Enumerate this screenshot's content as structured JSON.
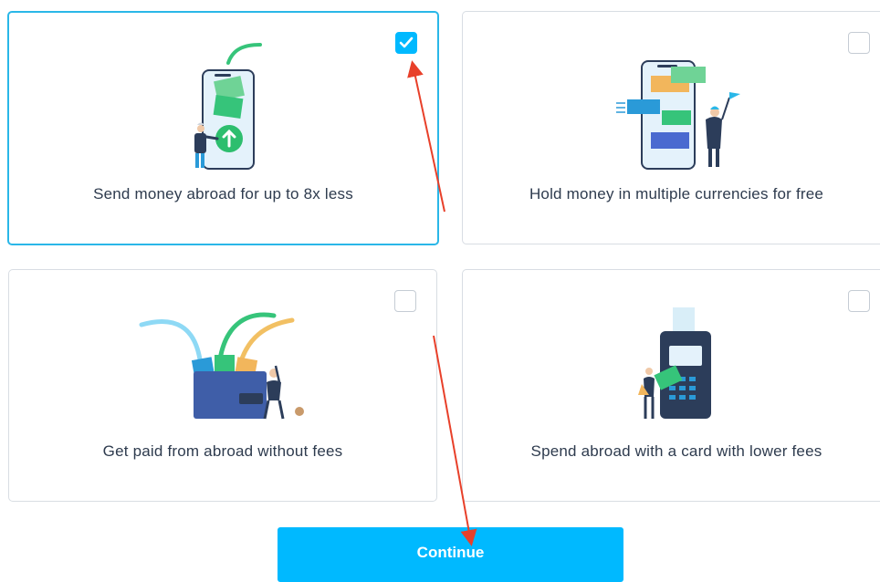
{
  "cards": [
    {
      "title": "Send money abroad for up to 8x less",
      "checked": true
    },
    {
      "title": "Hold money in multiple currencies for free",
      "checked": false
    },
    {
      "title": "Get paid from abroad without fees",
      "checked": false
    },
    {
      "title": "Spend abroad with a card with lower fees",
      "checked": false
    }
  ],
  "continue_label": "Continue",
  "colors": {
    "accent": "#00b9ff",
    "selected_border": "#2ab7e8",
    "annotation_arrow": "#e8402a",
    "text": "#2e3b4e"
  }
}
